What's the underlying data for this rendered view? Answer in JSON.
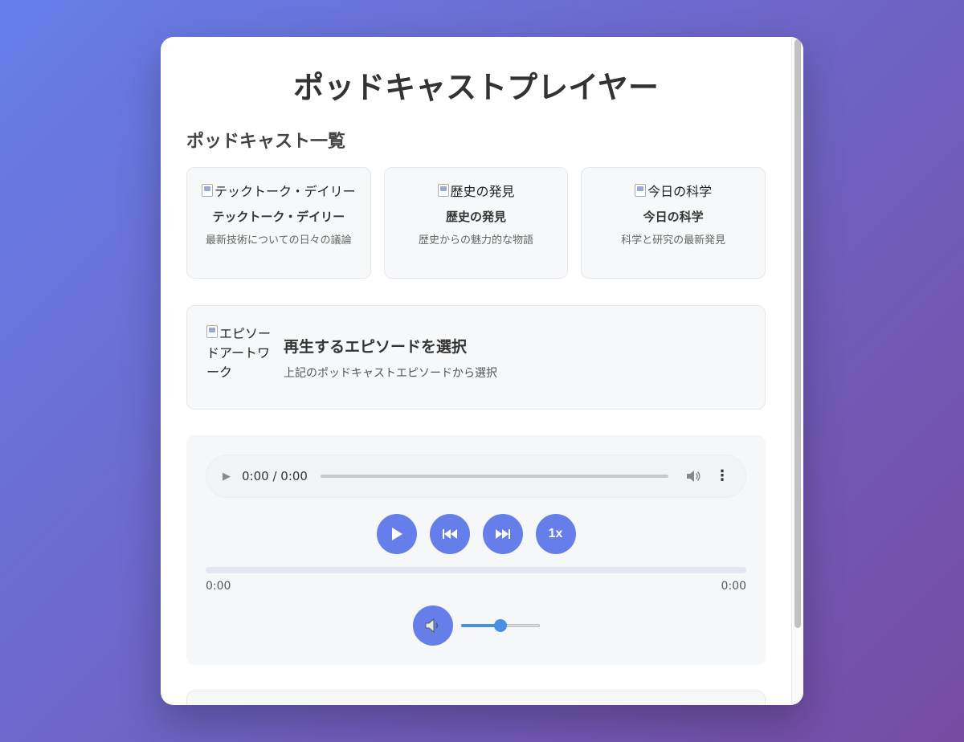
{
  "app": {
    "title": "ポッドキャストプレイヤー"
  },
  "podcast_list": {
    "heading": "ポッドキャスト一覧",
    "items": [
      {
        "image_alt": "テックトーク・デイリー",
        "title": "テックトーク・デイリー",
        "description": "最新技術についての日々の議論"
      },
      {
        "image_alt": "歴史の発見",
        "title": "歴史の発見",
        "description": "歴史からの魅力的な物語"
      },
      {
        "image_alt": "今日の科学",
        "title": "今日の科学",
        "description": "科学と研究の最新発見"
      }
    ]
  },
  "now_playing": {
    "artwork_alt": "エピソードアートワーク",
    "title": "再生するエピソードを選択",
    "subtitle": "上記のポッドキャストエピソードから選択"
  },
  "player": {
    "native_time": "0:00 / 0:00",
    "speed_label": "1x",
    "current_time": "0:00",
    "duration": "0:00",
    "progress": 0,
    "volume": 0.5,
    "accent_color": "#667eea",
    "slider_color": "#4a90e2",
    "icons": {
      "play": "play-icon",
      "previous": "skip-back-icon",
      "next": "skip-forward-icon",
      "volume": "speaker-icon",
      "more": "more-vertical-icon"
    }
  }
}
